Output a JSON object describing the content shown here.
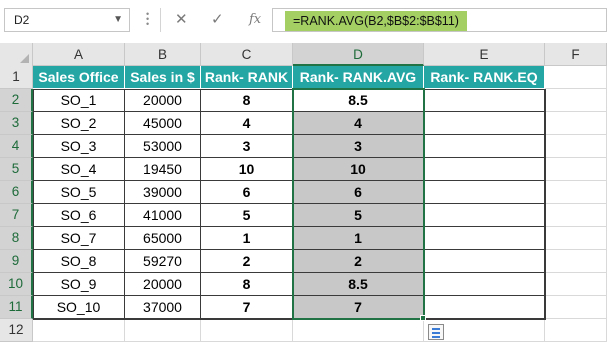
{
  "formula_bar": {
    "cell_ref": "D2",
    "cancel_icon": "✕",
    "enter_icon": "✓",
    "fx_label": "fx",
    "formula": "=RANK.AVG(B2,$B$2:$B$11)"
  },
  "columns": [
    "A",
    "B",
    "C",
    "D",
    "E",
    "F"
  ],
  "rows": [
    "1",
    "2",
    "3",
    "4",
    "5",
    "6",
    "7",
    "8",
    "9",
    "10",
    "11",
    "12"
  ],
  "table": {
    "headers": [
      "Sales Office",
      "Sales in $",
      "Rank- RANK",
      "Rank- RANK.AVG",
      "Rank- RANK.EQ"
    ],
    "rows": [
      [
        "SO_1",
        "20000",
        "8",
        "8.5",
        ""
      ],
      [
        "SO_2",
        "45000",
        "4",
        "4",
        ""
      ],
      [
        "SO_3",
        "53000",
        "3",
        "3",
        ""
      ],
      [
        "SO_4",
        "19450",
        "10",
        "10",
        ""
      ],
      [
        "SO_5",
        "39000",
        "6",
        "6",
        ""
      ],
      [
        "SO_6",
        "41000",
        "5",
        "5",
        ""
      ],
      [
        "SO_7",
        "65000",
        "1",
        "1",
        ""
      ],
      [
        "SO_8",
        "59270",
        "2",
        "2",
        ""
      ],
      [
        "SO_9",
        "20000",
        "8",
        "8.5",
        ""
      ],
      [
        "SO_10",
        "37000",
        "7",
        "7",
        ""
      ]
    ]
  },
  "colors": {
    "header_fill": "#24a6a4",
    "formula_highlight": "#a3cf63",
    "selection_border": "#217346",
    "selection_fill": "#c8c8c8"
  }
}
